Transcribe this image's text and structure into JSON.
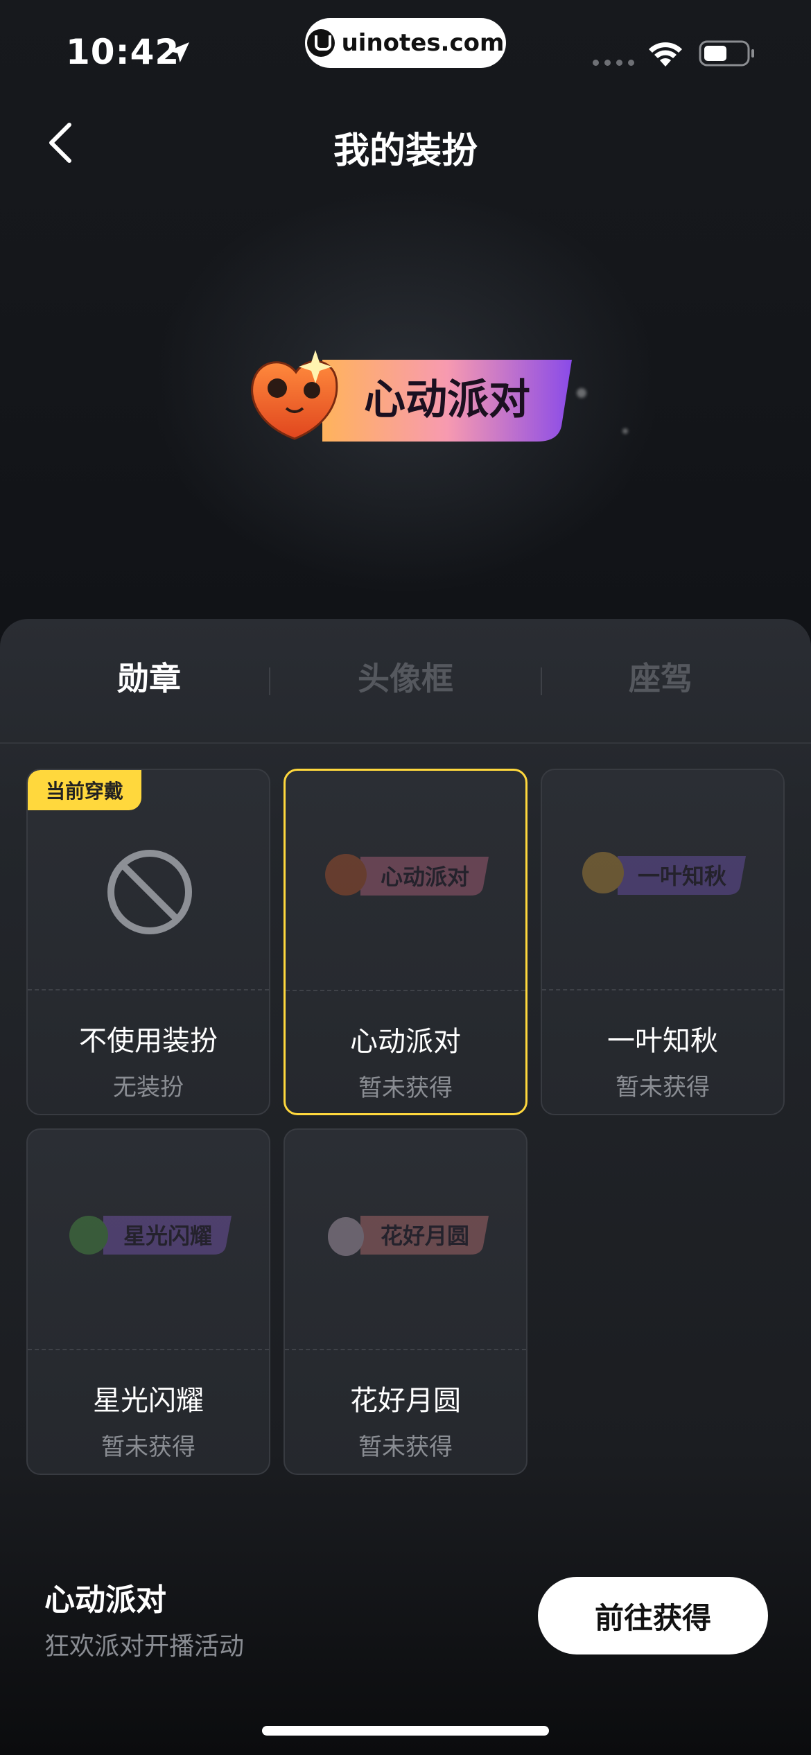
{
  "status_bar": {
    "time": "10:42",
    "url": "uinotes.com"
  },
  "nav": {
    "title": "我的装扮"
  },
  "hero": {
    "badge_text": "心动派对"
  },
  "tabs": [
    {
      "label": "勋章",
      "active": true
    },
    {
      "label": "头像框",
      "active": false
    },
    {
      "label": "座驾",
      "active": false
    }
  ],
  "cards": [
    {
      "name": "不使用装扮",
      "sub": "无装扮",
      "tag": "当前穿戴",
      "art": "ban-icon"
    },
    {
      "name": "心动派对",
      "sub": "暂未获得",
      "art_text": "心动派对",
      "selected": true
    },
    {
      "name": "一叶知秋",
      "sub": "暂未获得",
      "art_text": "一叶知秋"
    },
    {
      "name": "星光闪耀",
      "sub": "暂未获得",
      "art_text": "星光闪耀"
    },
    {
      "name": "花好月圆",
      "sub": "暂未获得",
      "art_text": "花好月圆"
    }
  ],
  "bottom": {
    "title": "心动派对",
    "subtitle": "狂欢派对开播活动",
    "action_label": "前往获得"
  },
  "colors": {
    "accent_yellow": "#ffd83d",
    "background": "#0c0d10"
  }
}
